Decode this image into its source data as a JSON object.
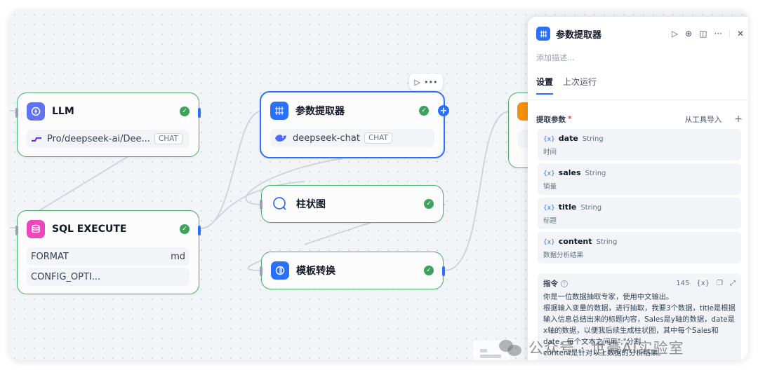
{
  "nodes": {
    "llm": {
      "title": "LLM",
      "model": "Pro/deepseek-ai/Dee...",
      "mode": "CHAT"
    },
    "sql": {
      "title": "SQL EXECUTE",
      "rows": [
        {
          "label": "FORMAT",
          "value": "md"
        },
        {
          "label": "CONFIG_OPTI...",
          "value": ""
        }
      ]
    },
    "extractor": {
      "title": "参数提取器",
      "model": "deepseek-chat",
      "mode": "CHAT"
    },
    "bar_chart": {
      "title": "柱状图"
    },
    "template": {
      "title": "模板转换"
    }
  },
  "panel": {
    "title": "参数提取器",
    "description_placeholder": "添加描述...",
    "tabs": [
      {
        "label": "设置",
        "active": true
      },
      {
        "label": "上次运行",
        "active": false
      }
    ],
    "section_label": "提取参数",
    "import_label": "从工具导入",
    "add_symbol": "+",
    "params": [
      {
        "name": "date",
        "type": "String",
        "desc": "时间"
      },
      {
        "name": "sales",
        "type": "String",
        "desc": "销量"
      },
      {
        "name": "title",
        "type": "String",
        "desc": "标题"
      },
      {
        "name": "content",
        "type": "String",
        "desc": "数据分析结果"
      }
    ],
    "prompt": {
      "label": "指令",
      "count": "145",
      "var_symbol": "{x}",
      "text": "你是一位数据抽取专家，使用中文输出。\n根据输入变量的数据，进行抽取，我要3个数据，title是根据输入信息总结出来的标题内容，Sales是y轴的数据，date是x轴的数据，以便我后续生成柱状图，其中每个Sales和date，每个文本之间用\";\"分割\ncontent是针对以上数据的分析结果。"
    }
  },
  "watermark": {
    "text": "公众号 · 世豪AI实验室"
  },
  "colors": {
    "success": "#3ea25c",
    "accent": "#2970ff",
    "node_border": "#47b36b"
  },
  "icons": [
    "llm-icon",
    "database-icon",
    "extractor-icon",
    "bar-chart-icon",
    "template-icon",
    "check-icon",
    "play-icon",
    "more-icon",
    "plus-icon",
    "close-icon",
    "expand-icon",
    "copy-icon"
  ]
}
